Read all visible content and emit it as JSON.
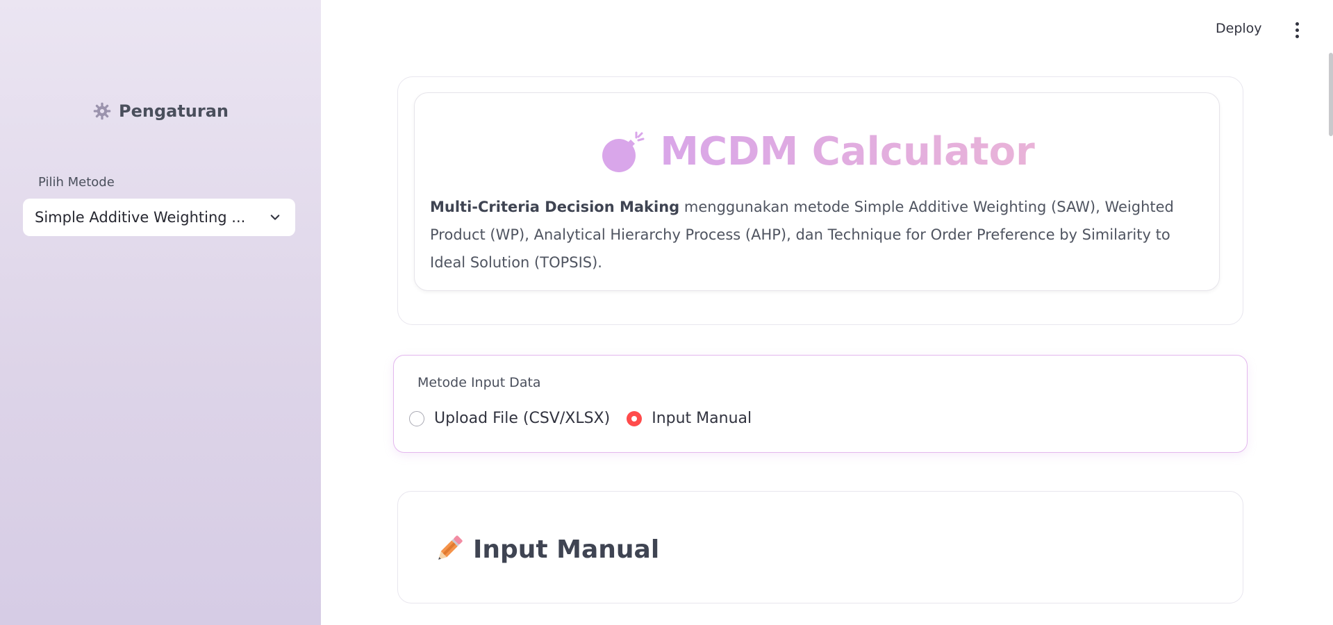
{
  "sidebar": {
    "title": "Pengaturan",
    "select_label": "Pilih Metode",
    "select_value": "Simple Additive Weighting ..."
  },
  "header": {
    "deploy_label": "Deploy"
  },
  "hero": {
    "title": "MCDM Calculator",
    "desc_bold": "Multi-Criteria Decision Making",
    "desc_rest": " menggunakan metode Simple Additive Weighting (SAW), Weighted Product (WP), Analytical Hierarchy Process (AHP), dan Technique for Order Preference by Similarity to Ideal Solution (TOPSIS)."
  },
  "input_method": {
    "legend": "Metode Input Data",
    "options": [
      {
        "label": "Upload File (CSV/XLSX)",
        "selected": false
      },
      {
        "label": "Input Manual",
        "selected": true
      }
    ]
  },
  "manual": {
    "title": "Input Manual"
  },
  "colors": {
    "accent": "#ff4b4b",
    "title_gradient_start": "#d9a6e8",
    "title_gradient_end": "#e9b3d8",
    "sidebar_bg": "#e4dcee"
  },
  "icons": {
    "sidebar_title": "gear-icon",
    "hero": "bomb-icon",
    "manual": "pencil-icon",
    "select": "chevron-down-icon",
    "menu": "kebab-menu-icon"
  }
}
